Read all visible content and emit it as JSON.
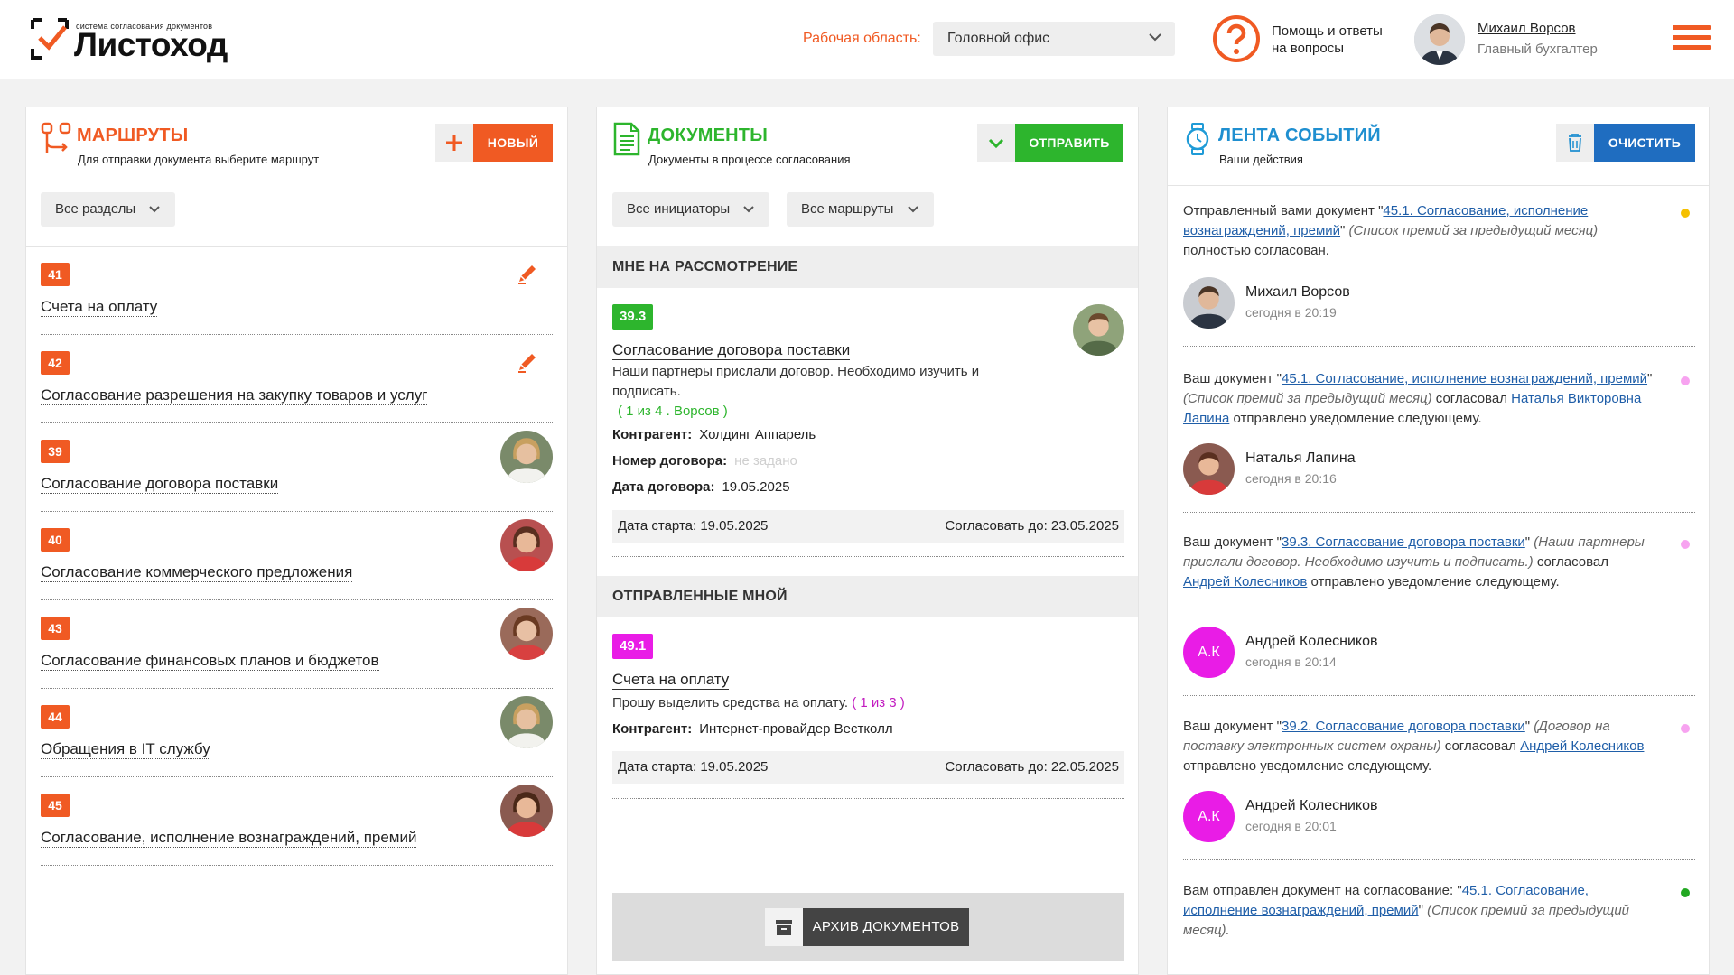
{
  "header": {
    "logo_small": "система согласования документов",
    "logo_big": "Листоход",
    "workspace_label": "Рабочая область:",
    "workspace_value": "Головной офис",
    "help_line1": "Помощь и ответы",
    "help_line2": "на вопросы",
    "user_name": "Михаил Ворсов",
    "user_role": "Главный бухгалтер"
  },
  "colors": {
    "accent": "#f05a23",
    "green": "#2db52d",
    "blue": "#1f6dc0",
    "magenta": "#e91ce6"
  },
  "routes": {
    "title": "МАРШРУТЫ",
    "subtitle": "Для отправки документа выберите маршрут",
    "new_button": "НОВЫЙ",
    "filter": "Все разделы",
    "items": [
      {
        "id": "41",
        "name": "Счета на оплату",
        "action": "pencil-icon"
      },
      {
        "id": "42",
        "name": "Согласование разрешения на закупку товаров и услуг",
        "action": "pencil-icon"
      },
      {
        "id": "39",
        "name": "Согласование договора поставки",
        "action": "avatar"
      },
      {
        "id": "40",
        "name": "Согласование коммерческого предложения",
        "action": "avatar"
      },
      {
        "id": "43",
        "name": "Согласование финансовых планов и бюджетов",
        "action": "avatar"
      },
      {
        "id": "44",
        "name": "Обращения в IT службу",
        "action": "avatar"
      },
      {
        "id": "45",
        "name": "Согласование, исполнение вознаграждений, премий",
        "action": "avatar"
      }
    ]
  },
  "documents": {
    "title": "ДОКУМЕНТЫ",
    "subtitle": "Документы в процессе согласования",
    "send_button": "ОТПРАВИТЬ",
    "filter_initiators": "Все инициаторы",
    "filter_routes": "Все маршруты",
    "section_review": "МНЕ НА РАССМОТРЕНИЕ",
    "section_sent": "ОТПРАВЛЕННЫЕ МНОЙ",
    "doc1": {
      "badge": "39.3",
      "title": "Согласование договора поставки",
      "text": "Наши партнеры прислали договор. Необходимо изучить и подписать.",
      "progress": "( 1 из 4 . Ворсов )",
      "contractor_label": "Контрагент:",
      "contractor": "Холдинг Аппарель",
      "number_label": "Номер договора:",
      "number": "не задано",
      "date_label": "Дата договора:",
      "date": "19.05.2025",
      "start": "Дата старта: 19.05.2025",
      "due": "Согласовать до: 23.05.2025"
    },
    "doc2": {
      "badge": "49.1",
      "title": "Счета на оплату",
      "text": "Прошу выделить средства на оплату.",
      "progress": "( 1 из 3 )",
      "contractor_label": "Контрагент:",
      "contractor": "Интернет-провайдер Вестколл",
      "start": "Дата старта: 19.05.2025",
      "due": "Согласовать до: 22.05.2025"
    },
    "archive_button": "АРХИВ ДОКУМЕНТОВ"
  },
  "feed": {
    "title": "ЛЕНТА СОБЫТИЙ",
    "subtitle": "Ваши действия",
    "clear_button": "ОЧИСТИТЬ",
    "items": [
      {
        "pre": "Отправленный вами документ \"",
        "link": "45.1. Согласование, исполнение вознаграждений, премий",
        "mid": "\" ",
        "italic": "(Список премий за предыдущий месяц)",
        "post": " полностью согласован.",
        "link2": "",
        "post2": "",
        "user": "Михаил Ворсов",
        "time": "сегодня в 20:19",
        "dot": "#f5c000"
      },
      {
        "pre": "Ваш документ \"",
        "link": "45.1. Согласование, исполнение вознаграждений, премий",
        "mid": "\" ",
        "italic": "(Список премий за предыдущий месяц)",
        "post": " согласовал ",
        "link2": "Наталья Викторовна Лапина",
        "post2": " отправлено уведомление следующему.",
        "user": "Наталья Лапина",
        "time": "сегодня в 20:16",
        "dot": "#f7a3f0"
      },
      {
        "pre": "Ваш документ \"",
        "link": "39.3. Согласование договора поставки",
        "mid": "\" ",
        "italic": "(Наши партнеры прислали договор. Необходимо изучить и подписать.)",
        "post": " согласовал ",
        "link2": "Андрей Колесников",
        "post2": " отправлено уведомление следующему.",
        "user": "Андрей Колесников",
        "initials": "А.К",
        "time": "сегодня в 20:14",
        "dot": "#f7a3f0"
      },
      {
        "pre": "Ваш документ \"",
        "link": "39.2. Согласование договора поставки",
        "mid": "\" ",
        "italic": "(Договор на поставку электронных систем охраны)",
        "post": " согласовал ",
        "link2": "Андрей Колесников",
        "post2": " отправлено уведомление следующему.",
        "user": "Андрей Колесников",
        "initials": "А.К",
        "time": "сегодня в 20:01",
        "dot": "#f7a3f0"
      },
      {
        "pre": "Вам отправлен документ на согласование: \"",
        "link": "45.1. Согласование, исполнение вознаграждений, премий",
        "mid": "\" ",
        "italic": "(Список премий за предыдущий месяц).",
        "post": "",
        "link2": "",
        "post2": "",
        "dot": "#22a822"
      }
    ]
  }
}
